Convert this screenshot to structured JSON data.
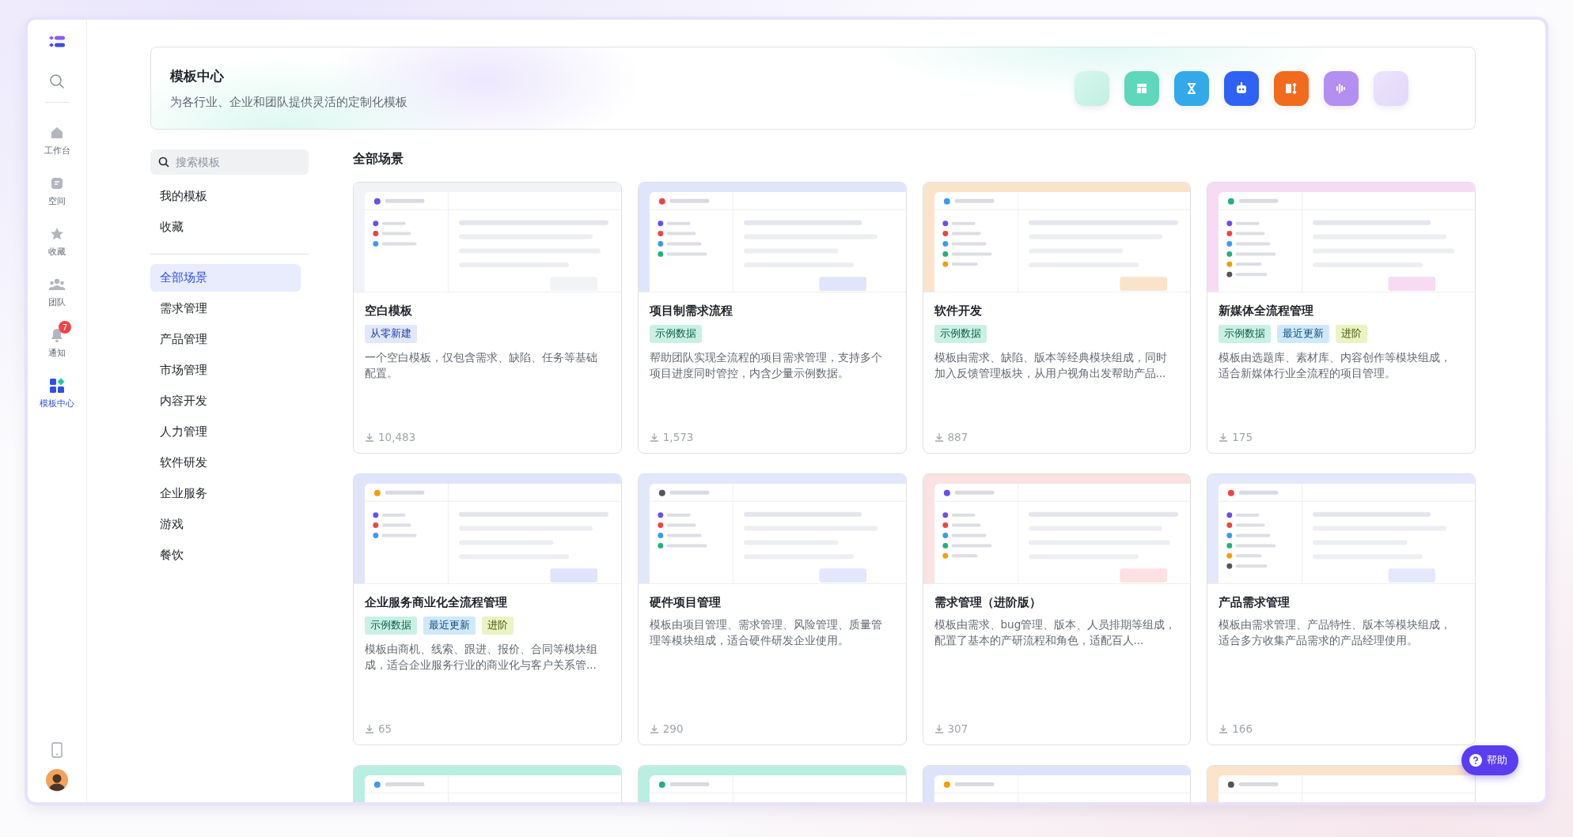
{
  "sidebar": {
    "items": [
      {
        "label": "工作台",
        "kind": "home",
        "selected": false
      },
      {
        "label": "空间",
        "kind": "space",
        "selected": false
      },
      {
        "label": "收藏",
        "kind": "star",
        "selected": false
      },
      {
        "label": "团队",
        "kind": "team",
        "selected": false
      },
      {
        "label": "通知",
        "kind": "bell",
        "selected": false,
        "badge": "7"
      },
      {
        "label": "模板中心",
        "kind": "grid",
        "selected": true
      }
    ]
  },
  "header": {
    "title": "模板中心",
    "subtitle": "为各行业、企业和团队提供灵活的定制化模板"
  },
  "left_panel": {
    "search": {
      "placeholder": "搜索模板"
    },
    "links": [
      "我的模板",
      "收藏"
    ],
    "categories": [
      {
        "label": "全部场景",
        "selected": true
      },
      {
        "label": "需求管理",
        "selected": false
      },
      {
        "label": "产品管理",
        "selected": false
      },
      {
        "label": "市场管理",
        "selected": false
      },
      {
        "label": "内容开发",
        "selected": false
      },
      {
        "label": "人力管理",
        "selected": false
      },
      {
        "label": "软件研发",
        "selected": false
      },
      {
        "label": "企业服务",
        "selected": false
      },
      {
        "label": "游戏",
        "selected": false
      },
      {
        "label": "餐饮",
        "selected": false
      }
    ]
  },
  "content": {
    "title": "全部场景",
    "cards": [
      {
        "color": "#f2f3f6",
        "title": "空白模板",
        "tags": [
          {
            "text": "从零新建",
            "kind": "new"
          }
        ],
        "description": "一个空白模板，仅包含需求、缺陷、任务等基础配置。",
        "downloads": "10,483"
      },
      {
        "color": "#e1e5fb",
        "title": "项目制需求流程",
        "tags": [
          {
            "text": "示例数据",
            "kind": "sample"
          }
        ],
        "description": "帮助团队实现全流程的项目需求管理，支持多个项目进度同时管控，内含少量示例数据。",
        "downloads": "1,573"
      },
      {
        "color": "#fbe3cb",
        "title": "软件开发",
        "tags": [
          {
            "text": "示例数据",
            "kind": "sample"
          }
        ],
        "description": "模板由需求、缺陷、版本等经典模块组成，同时加入反馈管理板块，从用户视角出发帮助产品...",
        "downloads": "887"
      },
      {
        "color": "#f6dbf2",
        "title": "新媒体全流程管理",
        "tags": [
          {
            "text": "示例数据",
            "kind": "sample"
          },
          {
            "text": "最近更新",
            "kind": "recent"
          },
          {
            "text": "进阶",
            "kind": "advanced"
          }
        ],
        "description": "模板由选题库、素材库、内容创作等模块组成，适合新媒体行业全流程的项目管理。",
        "downloads": "175"
      },
      {
        "color": "#dfe4fb",
        "title": "企业服务商业化全流程管理",
        "tags": [
          {
            "text": "示例数据",
            "kind": "sample"
          },
          {
            "text": "最近更新",
            "kind": "recent"
          },
          {
            "text": "进阶",
            "kind": "advanced"
          }
        ],
        "description": "模板由商机、线索、跟进、报价、合同等模块组成，适合企业服务行业的商业化与客户关系管...",
        "downloads": "65"
      },
      {
        "color": "#e2e7fb",
        "title": "硬件项目管理",
        "description": "模板由项目管理、需求管理、风险管理、质量管理等模块组成，适合硬件研发企业使用。",
        "downloads": "290"
      },
      {
        "color": "#fbe1e1",
        "title": "需求管理（进阶版）",
        "description": "模板由需求、bug管理、版本、人员排期等组成，配置了基本的产研流程和角色，适配百人...",
        "downloads": "307"
      },
      {
        "color": "#e5e7fb",
        "title": "产品需求管理",
        "description": "模板由需求管理、产品特性、版本等模块组成，适合多方收集产品需求的产品经理使用。",
        "downloads": "166"
      }
    ],
    "more_cards": [
      {
        "color": "#b8efe1"
      },
      {
        "color": "#b8efe1"
      },
      {
        "color": "#dde3fb"
      },
      {
        "color": "#fbe3cb"
      }
    ]
  },
  "help_button": {
    "label": "帮助"
  }
}
